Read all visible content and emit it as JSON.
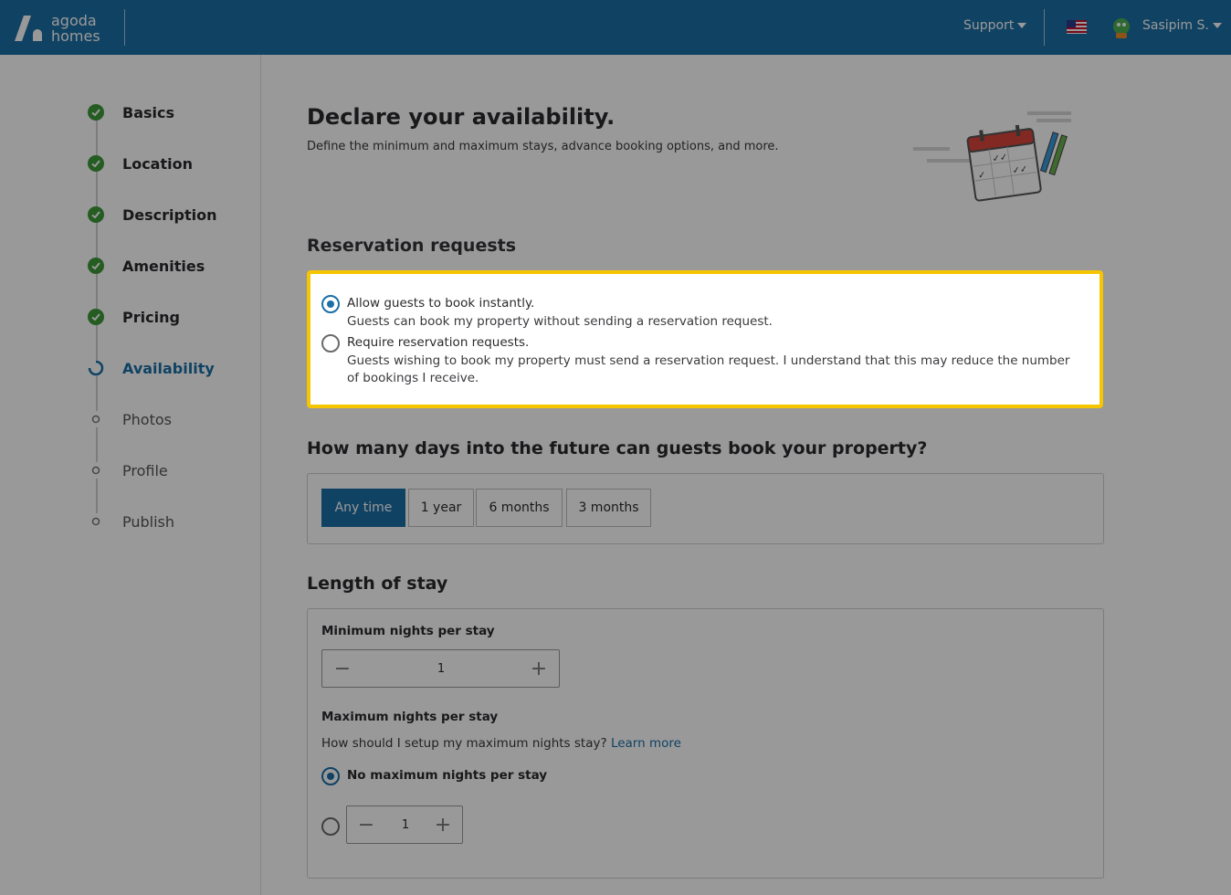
{
  "header": {
    "brand_line1": "agoda",
    "brand_line2": "homes",
    "support_label": "Support",
    "username": "Sasipim S.",
    "flag_icon": "us-flag-icon",
    "bar_color": "#1b6fa6"
  },
  "sidebar": {
    "steps": [
      {
        "label": "Basics",
        "status": "done"
      },
      {
        "label": "Location",
        "status": "done"
      },
      {
        "label": "Description",
        "status": "done"
      },
      {
        "label": "Amenities",
        "status": "done"
      },
      {
        "label": "Pricing",
        "status": "done"
      },
      {
        "label": "Availability",
        "status": "current"
      },
      {
        "label": "Photos",
        "status": "pending"
      },
      {
        "label": "Profile",
        "status": "pending"
      },
      {
        "label": "Publish",
        "status": "pending"
      }
    ]
  },
  "main": {
    "title": "Declare your availability.",
    "subtitle": "Define the minimum and maximum stays, advance booking options, and more.",
    "reservation": {
      "heading": "Reservation requests",
      "options": [
        {
          "title": "Allow guests to book instantly.",
          "desc": "Guests can book my property without sending a reservation request.",
          "selected": true
        },
        {
          "title": "Require reservation requests.",
          "desc": "Guests wishing to book my property must send a reservation request. I understand that this may reduce the number of bookings I receive.",
          "selected": false
        }
      ]
    },
    "future": {
      "heading": "How many days into the future can guests book your property?",
      "options": [
        "Any time",
        "1 year",
        "6 months",
        "3 months"
      ],
      "selected": "Any time"
    },
    "stay": {
      "heading": "Length of stay",
      "min_label": "Minimum nights per stay",
      "min_value": "1",
      "max_label": "Maximum nights per stay",
      "help_text": "How should I setup my maximum nights stay?",
      "help_link": "Learn more",
      "no_max_label": "No maximum nights per stay",
      "max_value": "1"
    }
  }
}
